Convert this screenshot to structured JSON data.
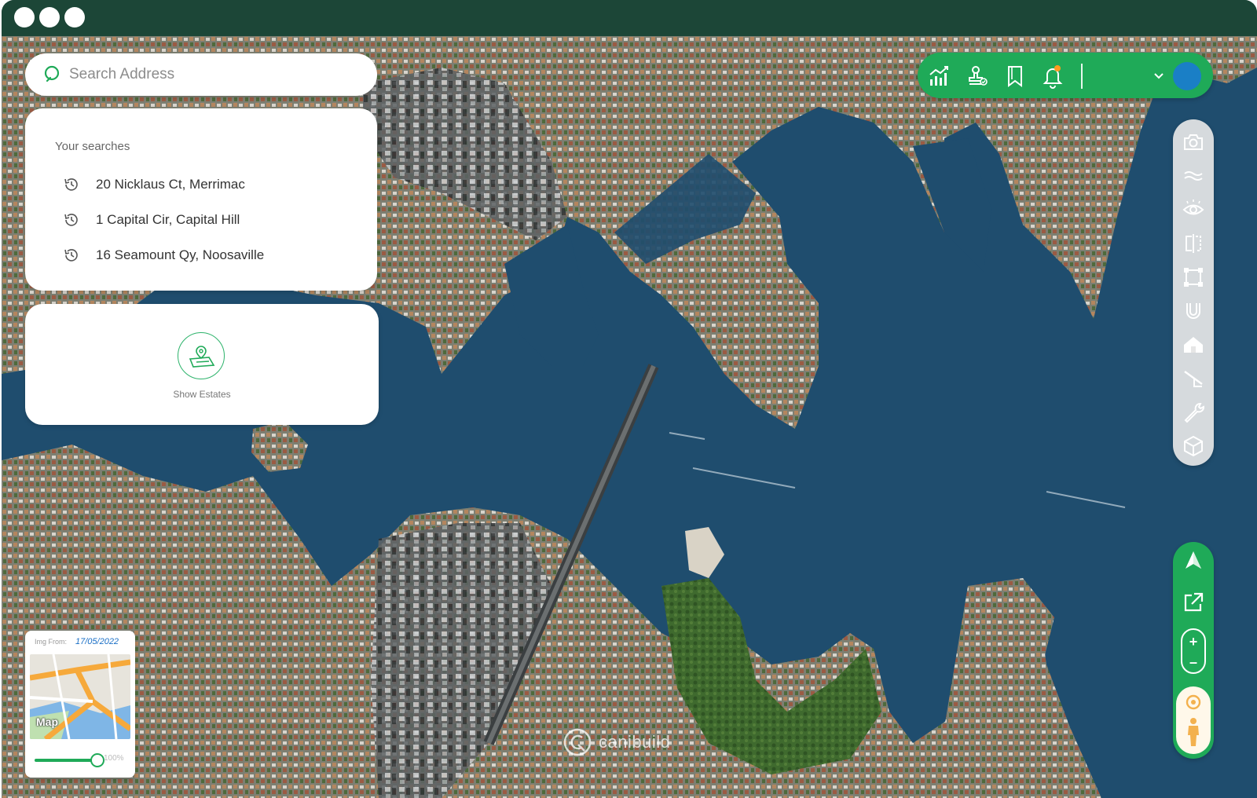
{
  "window": {
    "controls": [
      "close",
      "minimize",
      "maximize"
    ]
  },
  "search": {
    "placeholder": "Search Address",
    "value": ""
  },
  "recent_searches": {
    "title": "Your searches",
    "items": [
      {
        "label": "20 Nicklaus Ct, Merrimac",
        "icon": "history-icon"
      },
      {
        "label": "1 Capital Cir, Capital Hill",
        "icon": "history-icon"
      },
      {
        "label": "16 Seamount Qy, Noosaville",
        "icon": "history-icon"
      }
    ]
  },
  "estates": {
    "label": "Show Estates",
    "icon": "estate-map-pin-icon"
  },
  "toolbar": {
    "icons": [
      "analytics-chart-icon",
      "stamp-icon",
      "bookmark-icon",
      "bell-icon"
    ],
    "notification_dot_color": "#ff9a1f",
    "menu_icon": "chevron-down-icon",
    "avatar_color": "#1a7fc6"
  },
  "tools": {
    "icons": [
      "camera-icon",
      "water-waves-icon",
      "eye-icon",
      "split-view-icon",
      "measure-area-icon",
      "magnet-icon",
      "house-icon",
      "slope-icon",
      "wrench-icon",
      "box-3d-icon"
    ]
  },
  "navigation": {
    "compass_icon": "compass-north-icon",
    "external_icon": "external-link-icon",
    "zoom_in": "+",
    "zoom_out": "–",
    "streetview_icon": "pegman-icon"
  },
  "minimap": {
    "img_from_label": "Img From:",
    "date": "17/05/2022",
    "map_label": "Map",
    "opacity_percent": 100,
    "opacity_label": "100%"
  },
  "watermark": {
    "brand": "canibuild"
  },
  "colors": {
    "titlebar": "#1c4637",
    "accent_green": "#1faa58",
    "water": "#1f4d6e"
  }
}
